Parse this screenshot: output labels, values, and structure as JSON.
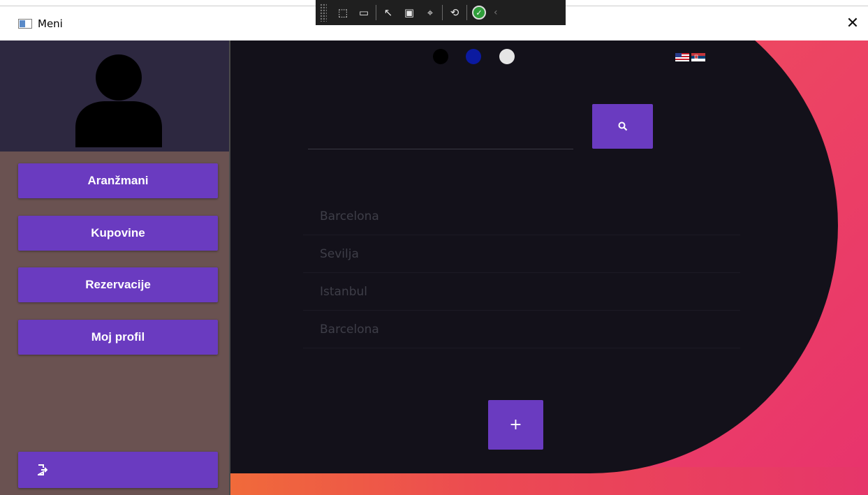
{
  "window": {
    "title": "Meni",
    "close_glyph": "✕"
  },
  "dev_toolbar": {
    "buttons": [
      "select-element-icon",
      "record-icon",
      "pointer-icon",
      "layout-icon",
      "inspect-icon",
      "refresh-icon",
      "check-icon",
      "chevron-left-icon"
    ],
    "glyphs": {
      "select": "⬚",
      "record": "▭",
      "pointer": "↖",
      "layout": "▣",
      "inspect": "⌖",
      "refresh": "⟲",
      "check": "✓",
      "chevron": "‹"
    }
  },
  "sidebar": {
    "buttons": [
      {
        "label": "Aranžmani"
      },
      {
        "label": "Kupovine"
      },
      {
        "label": "Rezervacije"
      },
      {
        "label": "Moj profil"
      }
    ],
    "logout_icon": "logout-icon"
  },
  "main": {
    "theme_dots": [
      "#000000",
      "#0b1aa0",
      "#e5e5e5"
    ],
    "flags": [
      "us-flag-icon",
      "serbia-flag-icon"
    ],
    "search": {
      "value": "",
      "icon": "search-icon"
    },
    "destinations": [
      "Barcelona",
      "Sevilja",
      "Istanbul",
      "Barcelona"
    ],
    "add_label": "+"
  },
  "colors": {
    "accent": "#6a3bc0",
    "sidebar_bg": "#6a5251",
    "avatar_bg": "#2d2840",
    "panel_bg": "#13111a",
    "gradient_start": "#f06a3a",
    "gradient_end": "#e6366a"
  }
}
